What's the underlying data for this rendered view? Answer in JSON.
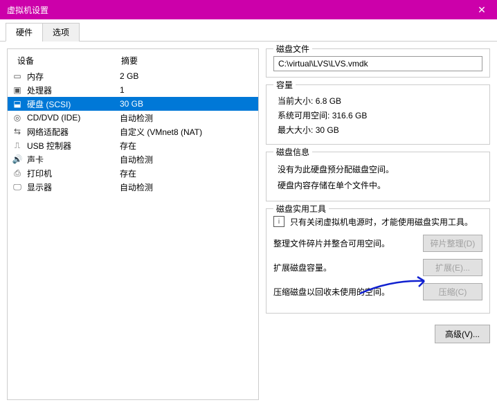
{
  "window": {
    "title": "虚拟机设置"
  },
  "tabs": [
    "硬件",
    "选项"
  ],
  "deviceHeaders": {
    "device": "设备",
    "summary": "摘要"
  },
  "devices": [
    {
      "name": "内存",
      "summary": "2 GB"
    },
    {
      "name": "处理器",
      "summary": "1"
    },
    {
      "name": "硬盘 (SCSI)",
      "summary": "30 GB"
    },
    {
      "name": "CD/DVD (IDE)",
      "summary": "自动检测"
    },
    {
      "name": "网络适配器",
      "summary": "自定义 (VMnet8 (NAT)"
    },
    {
      "name": "USB 控制器",
      "summary": "存在"
    },
    {
      "name": "声卡",
      "summary": "自动检测"
    },
    {
      "name": "打印机",
      "summary": "存在"
    },
    {
      "name": "显示器",
      "summary": "自动检测"
    }
  ],
  "right": {
    "diskFile": {
      "title": "磁盘文件",
      "path": "C:\\virtual\\LVS\\LVS.vmdk"
    },
    "capacity": {
      "title": "容量",
      "currentSizeLabel": "当前大小:",
      "currentSize": "6.8 GB",
      "freeSpaceLabel": "系统可用空间:",
      "freeSpace": "316.6 GB",
      "maxSizeLabel": "最大大小:",
      "maxSize": "30 GB"
    },
    "diskInfo": {
      "title": "磁盘信息",
      "line1": "没有为此硬盘预分配磁盘空间。",
      "line2": "硬盘内容存储在单个文件中。"
    },
    "utils": {
      "title": "磁盘实用工具",
      "tip": "只有关闭虚拟机电源时，才能使用磁盘实用工具。",
      "defrag": {
        "label": "整理文件碎片并整合可用空间。",
        "button": "碎片整理(D)"
      },
      "expand": {
        "label": "扩展磁盘容量。",
        "button": "扩展(E)..."
      },
      "compact": {
        "label": "压缩磁盘以回收未使用的空间。",
        "button": "压缩(C)"
      }
    },
    "advancedButton": "高级(V)..."
  }
}
